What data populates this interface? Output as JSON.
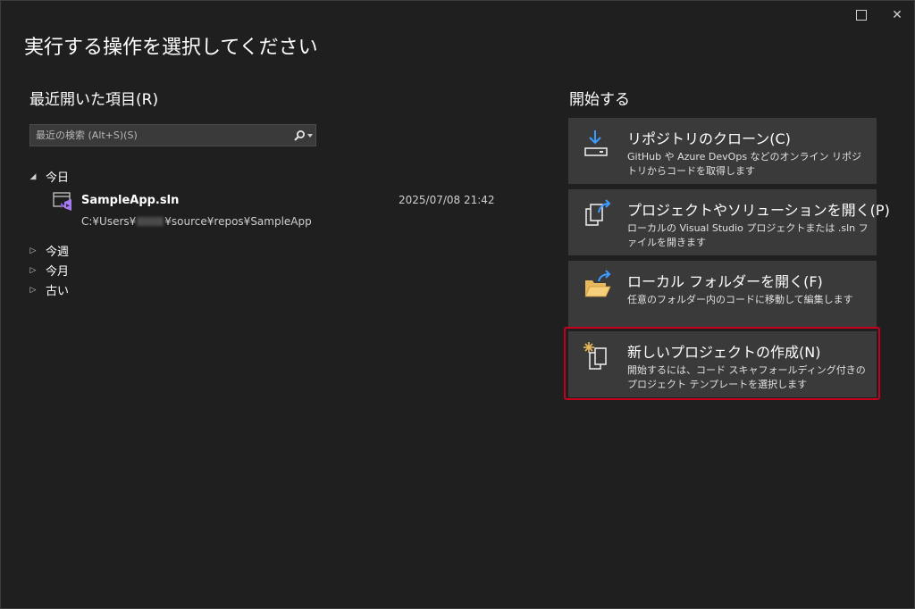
{
  "dialog": {
    "title": "実行する操作を選択してください"
  },
  "window_controls": {
    "maximize_icon": "maximize-icon",
    "close_glyph": "✕"
  },
  "recent": {
    "title": "最近開いた項目(R)",
    "search": {
      "placeholder": "最近の検索 (Alt+S)(S)",
      "icon": "search-icon"
    },
    "groups": [
      {
        "label": "今日",
        "expanded": true
      },
      {
        "label": "今週",
        "expanded": false
      },
      {
        "label": "今月",
        "expanded": false
      },
      {
        "label": "古い",
        "expanded": false
      }
    ],
    "items": [
      {
        "name": "SampleApp.sln",
        "date": "2025/07/08 21:42",
        "path_prefix": "C:¥Users¥",
        "path_suffix": "¥source¥repos¥SampleApp",
        "icon": "solution-file-icon"
      }
    ]
  },
  "start": {
    "title": "開始する",
    "cards": [
      {
        "title": "リポジトリのクローン(C)",
        "description": "GitHub や Azure DevOps などのオンライン リポジトリからコードを取得します",
        "icon": "clone-download-icon"
      },
      {
        "title": "プロジェクトやソリューションを開く(P)",
        "description": "ローカルの Visual Studio プロジェクトまたは .sln ファイルを開きます",
        "icon": "open-project-icon"
      },
      {
        "title": "ローカル フォルダーを開く(F)",
        "description": "任意のフォルダー内のコードに移動して編集します",
        "icon": "open-folder-icon"
      },
      {
        "title": "新しいプロジェクトの作成(N)",
        "description": "開始するには、コード スキャフォールディング付きのプロジェクト テンプレートを選択します",
        "icon": "new-project-icon",
        "highlighted": true
      }
    ]
  },
  "colors": {
    "background": "#1f1f1f",
    "card": "#3a3a3a",
    "highlight_border": "#c8001e",
    "accent_blue": "#3b9cff",
    "folder_yellow": "#e8b95c"
  }
}
